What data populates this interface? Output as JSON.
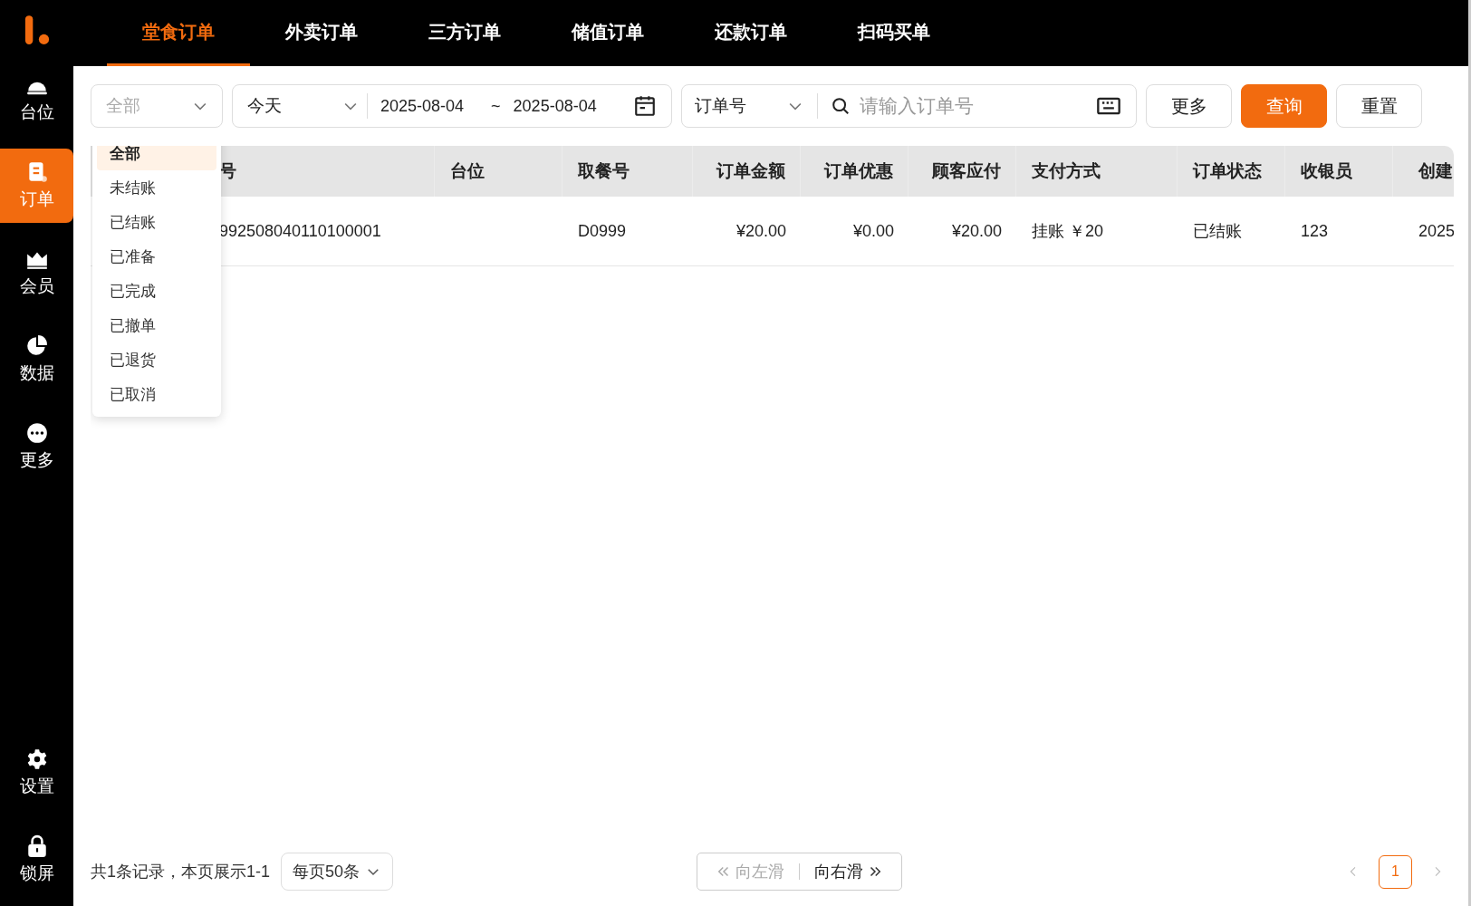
{
  "sidebar": {
    "items": [
      {
        "label": "台位",
        "selected": false
      },
      {
        "label": "订单",
        "selected": true
      },
      {
        "label": "会员",
        "selected": false
      },
      {
        "label": "数据",
        "selected": false
      },
      {
        "label": "更多",
        "selected": false
      },
      {
        "label": "设置",
        "selected": false
      },
      {
        "label": "锁屏",
        "selected": false
      }
    ]
  },
  "tabs": [
    {
      "label": "堂食订单",
      "selected": true
    },
    {
      "label": "外卖订单",
      "selected": false
    },
    {
      "label": "三方订单",
      "selected": false
    },
    {
      "label": "储值订单",
      "selected": false
    },
    {
      "label": "还款订单",
      "selected": false
    },
    {
      "label": "扫码买单",
      "selected": false
    }
  ],
  "filters": {
    "status": {
      "placeholder": "全部"
    },
    "period": {
      "value": "今天"
    },
    "start_date": "2025-08-04",
    "separator": "~",
    "end_date": "2025-08-04",
    "search_type": {
      "value": "订单号"
    },
    "search": {
      "placeholder": "请输入订单号"
    },
    "buttons": [
      {
        "label": "更多",
        "kind": "plain"
      },
      {
        "label": "查询",
        "kind": "primary"
      },
      {
        "label": "重置",
        "kind": "plain"
      }
    ]
  },
  "status_options": [
    {
      "label": "全部",
      "selected": true
    },
    {
      "label": "未结账",
      "selected": false
    },
    {
      "label": "已结账",
      "selected": false
    },
    {
      "label": "已准备",
      "selected": false
    },
    {
      "label": "已完成",
      "selected": false
    },
    {
      "label": "已撤单",
      "selected": false
    },
    {
      "label": "已退货",
      "selected": false
    },
    {
      "label": "已取消",
      "selected": false
    }
  ],
  "table": {
    "columns": [
      "号",
      "台位",
      "取餐号",
      "订单金额",
      "订单优惠",
      "顾客应付",
      "支付方式",
      "订单状态",
      "收银员",
      "创建"
    ],
    "rows": [
      [
        "992508040110100001",
        "",
        "D0999",
        "¥20.00",
        "¥0.00",
        "¥20.00",
        "挂账 ￥20",
        "已结账",
        "123",
        "2025"
      ]
    ]
  },
  "footer": {
    "summary": "共1条记录，本页展示1-1",
    "page_size": "每页50条",
    "scroll_buttons": [
      {
        "label": "向左滑",
        "disabled": true
      },
      {
        "label": "向右滑",
        "disabled": false
      }
    ],
    "pages": [
      {
        "label": "1",
        "selected": true
      }
    ],
    "prev_disabled": true,
    "next_disabled": true
  }
}
